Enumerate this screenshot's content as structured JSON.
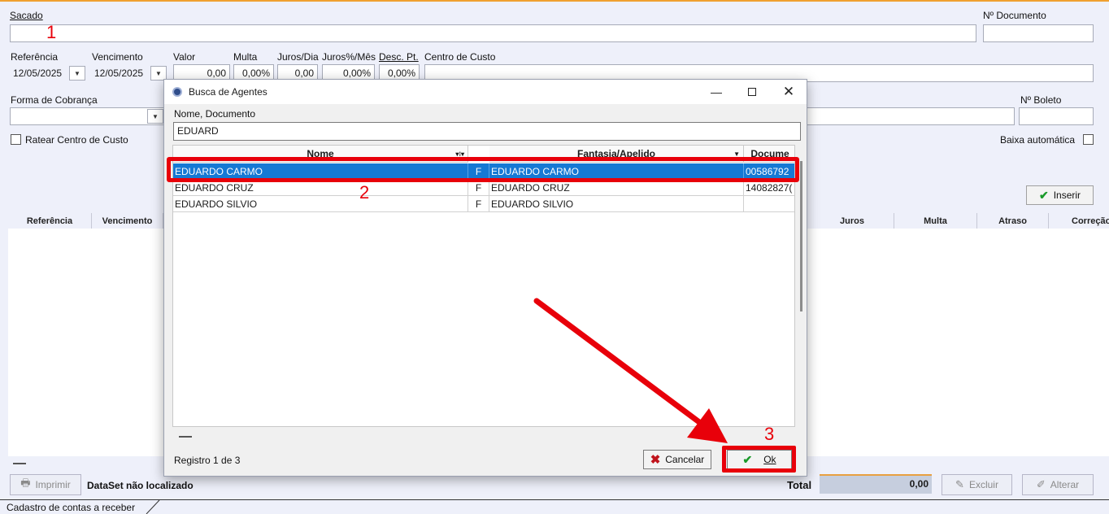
{
  "form": {
    "sacado_label": "Sacado",
    "sacado_value": "",
    "nro_documento_label": "Nº Documento",
    "referencia_label": "Referência",
    "referencia_value": "12/05/2025",
    "vencimento_label": "Vencimento",
    "vencimento_value": "12/05/2025",
    "valor_label": "Valor",
    "valor_value": "0,00",
    "multa_label": "Multa",
    "multa_value": "0,00%",
    "juros_dia_label": "Juros/Dia",
    "juros_dia_value": "0,00",
    "juros_mes_label": "Juros%/Mês",
    "juros_mes_value": "0,00%",
    "desc_pt_label": "Desc. Pt.",
    "desc_pt_value": "0,00%",
    "centro_custo_label": "Centro de Custo",
    "forma_cobranca_label": "Forma de Cobrança",
    "nro_boleto_label": "Nº Boleto",
    "ratear_label": "Ratear Centro de Custo",
    "baixa_auto_label": "Baixa automática",
    "inserir_label": "Inserir"
  },
  "grid": {
    "columns_left": [
      "Referência",
      "Vencimento"
    ],
    "columns_right": [
      "Juros",
      "Multa",
      "Atraso",
      "Correção"
    ]
  },
  "bottom": {
    "imprimir_label": "Imprimir",
    "dataset_status": "DataSet não localizado",
    "total_label": "Total",
    "total_value": "0,00",
    "excluir_label": "Excluir",
    "alterar_label": "Alterar",
    "status_bar": "Cadastro de contas a receber"
  },
  "dialog": {
    "title": "Busca de Agentes",
    "search_label": "Nome,  Documento",
    "search_value": "EDUARD",
    "columns": [
      "Nome",
      "Fantasia/Apelido",
      "Docume"
    ],
    "rows": [
      {
        "nome": "EDUARDO CARMO",
        "tipo": "F",
        "fantasia": "EDUARDO CARMO",
        "documento": "00586792"
      },
      {
        "nome": "EDUARDO CRUZ",
        "tipo": "F",
        "fantasia": "EDUARDO CRUZ",
        "documento": "14082827("
      },
      {
        "nome": "EDUARDO SILVIO",
        "tipo": "F",
        "fantasia": "EDUARDO SILVIO",
        "documento": ""
      }
    ],
    "registro": "Registro 1 de 3",
    "cancelar_label": "Cancelar",
    "ok_label": "Ok"
  },
  "annotations": {
    "step1": "1",
    "step2": "2",
    "step3": "3",
    "color": "#e8000a"
  }
}
